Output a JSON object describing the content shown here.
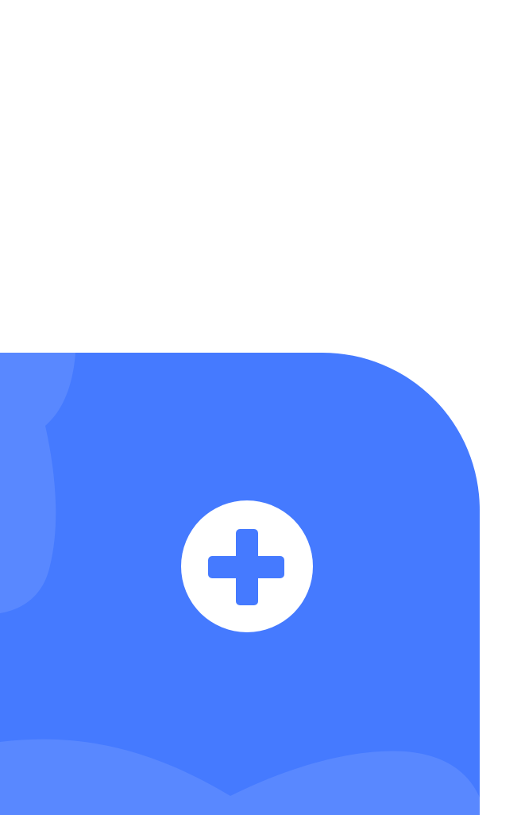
{
  "colors": {
    "background": "#FFFFFF",
    "card": "#457AFF",
    "card_shape_light": "#5988FF",
    "icon_circle": "#FFFFFF",
    "icon_plus": "#457AFF"
  },
  "add_button": {
    "icon": "plus-circle-icon"
  }
}
